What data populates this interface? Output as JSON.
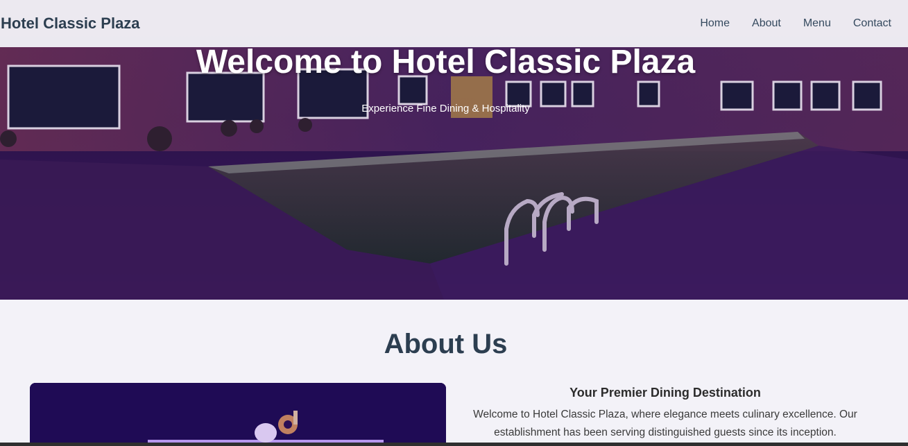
{
  "navbar": {
    "brand": "Hotel Classic Plaza",
    "links": [
      "Home",
      "About",
      "Menu",
      "Contact"
    ]
  },
  "hero": {
    "title": "Welcome to Hotel Classic Plaza",
    "subtitle": "Experience Fine Dining & Hospitality"
  },
  "about": {
    "title": "About Us",
    "heading": "Your Premier Dining Destination",
    "paragraph": "Welcome to Hotel Classic Plaza, where elegance meets culinary excellence. Our establishment has been serving distinguished guests since its inception."
  },
  "colors": {
    "heading": "#2c3e50",
    "hero_overlay": "#3a1a57",
    "background": "#f3f2f8"
  }
}
